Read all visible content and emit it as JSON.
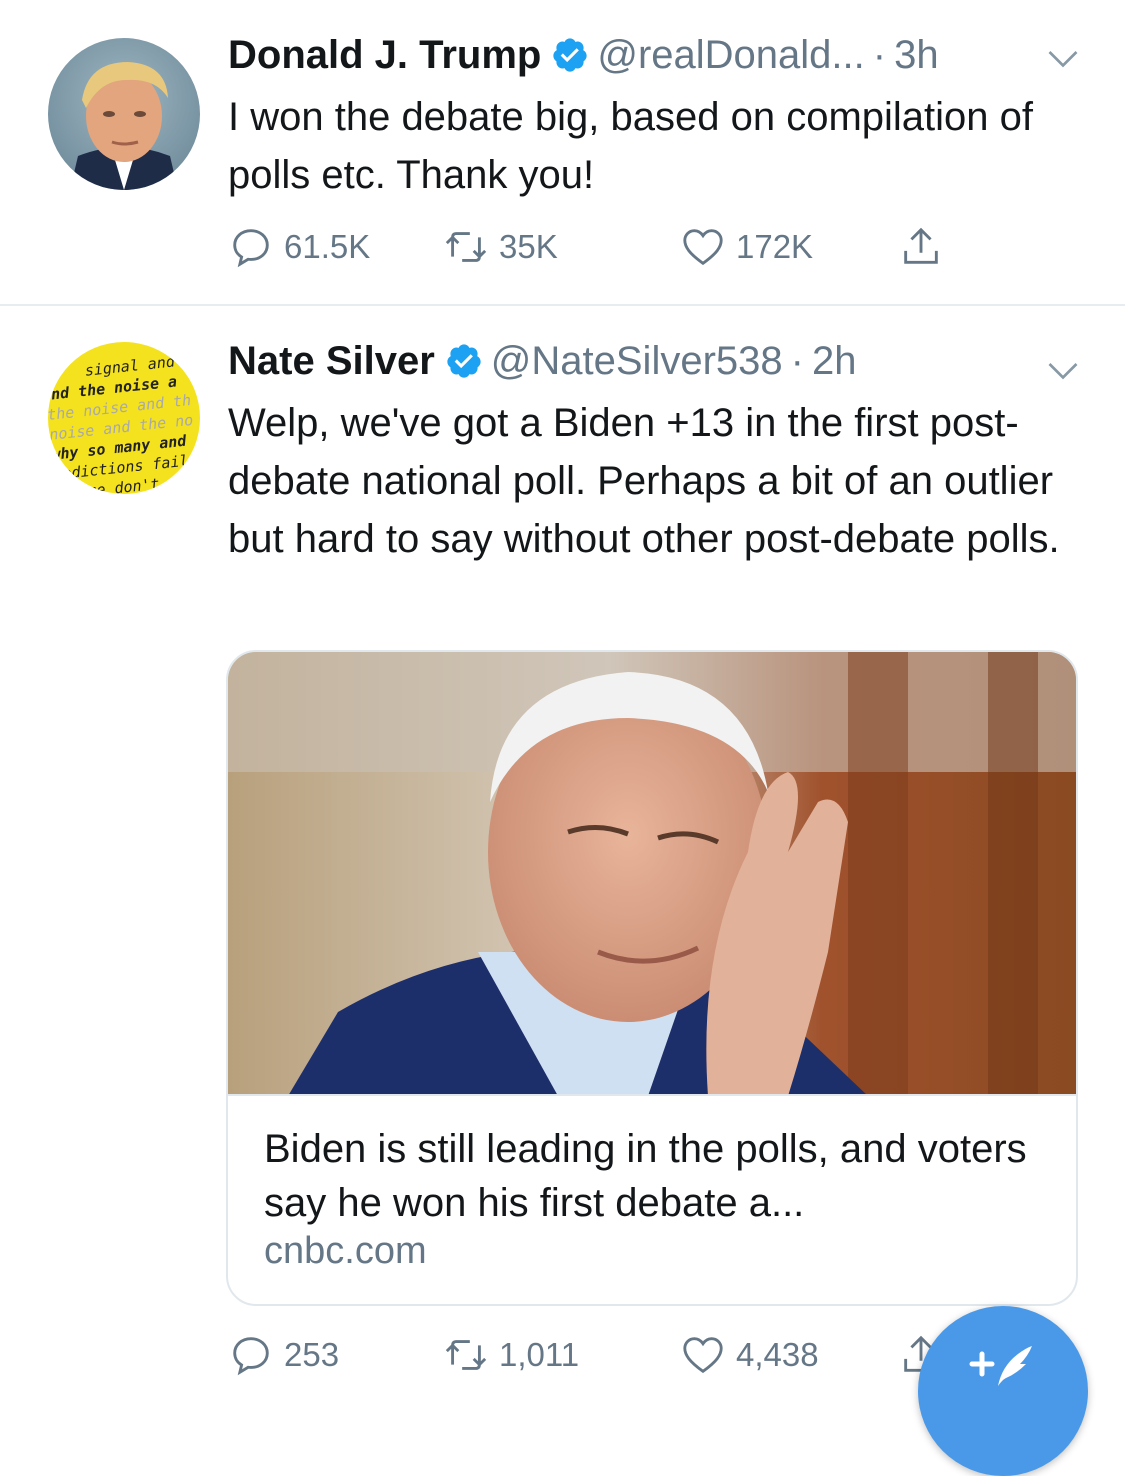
{
  "tweets": [
    {
      "name": "Donald J. Trump",
      "handle": "@realDonald...",
      "separator": "·",
      "time": "3h",
      "text": "I won the debate big, based on compilation of polls etc. Thank you!",
      "replies": "61.5K",
      "retweets": "35K",
      "likes": "172K"
    },
    {
      "name": "Nate Silver",
      "handle": "@NateSilver538",
      "separator": "·",
      "time": "2h",
      "text": "Welp, we've got a Biden +13 in the first post-debate national poll. Perhaps a bit of an outlier but hard to say without other post-debate polls.",
      "card": {
        "title": "Biden is still leading in the polls, and voters say he won his first debate a...",
        "domain": "cnbc.com"
      },
      "replies": "253",
      "retweets": "1,011",
      "likes": "4,438"
    }
  ],
  "avatar_text": {
    "lines": [
      "signal and",
      "nd the noise a",
      "the noise and th",
      "noise and the no",
      "why so many and",
      "redictions fail-",
      "some don't"
    ]
  },
  "icons": {
    "verified": "verified-badge-icon",
    "chevron": "chevron-down-icon",
    "reply": "reply-icon",
    "retweet": "retweet-icon",
    "like": "heart-icon",
    "share": "share-icon",
    "compose": "compose-tweet-icon"
  },
  "colors": {
    "accent": "#1da1f2",
    "fab": "#4a99e9",
    "muted": "#657786",
    "text": "#14171a",
    "divider": "#e6ecf0",
    "avatar_yellow": "#f4e21f"
  }
}
